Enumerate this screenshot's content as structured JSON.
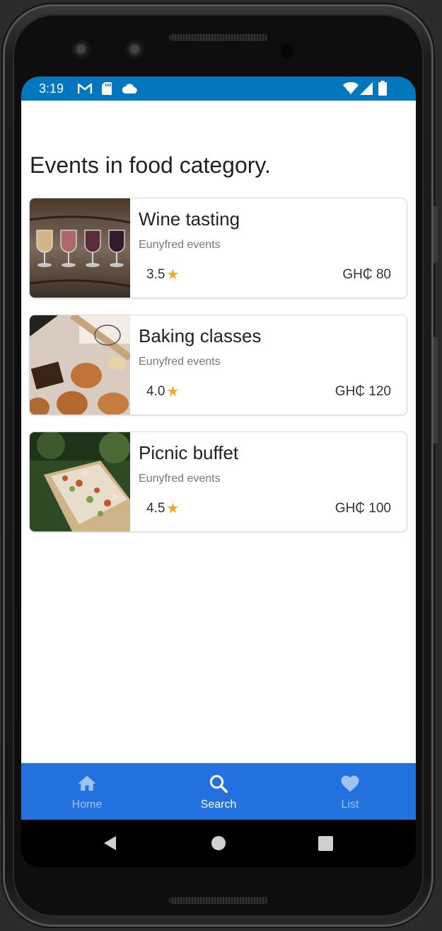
{
  "status_bar": {
    "time": "3:19",
    "icons": [
      "gmail-icon",
      "sd-card-icon",
      "cloud-icon",
      "wifi-icon",
      "signal-icon",
      "battery-icon"
    ],
    "color": "#0277bd"
  },
  "page": {
    "title": "Events in food category."
  },
  "events": [
    {
      "title": "Wine tasting",
      "organizer": "Eunyfred events",
      "rating": "3.5",
      "price": "GH₵ 80"
    },
    {
      "title": "Baking classes",
      "organizer": "Eunyfred events",
      "rating": "4.0",
      "price": "GH₵ 120"
    },
    {
      "title": "Picnic buffet",
      "organizer": "Eunyfred events",
      "rating": "4.5",
      "price": "GH₵ 100"
    }
  ],
  "bottom_nav": {
    "color": "#2370df",
    "items": [
      {
        "label": "Home",
        "icon": "home-icon",
        "active": false
      },
      {
        "label": "Search",
        "icon": "search-icon",
        "active": true
      },
      {
        "label": "List",
        "icon": "heart-icon",
        "active": false
      }
    ]
  },
  "system_nav": {
    "icons": [
      "back-icon",
      "home-circle-icon",
      "recents-icon"
    ]
  },
  "colors": {
    "star": "#f5a623",
    "nav_inactive": "#9ec3f5"
  }
}
